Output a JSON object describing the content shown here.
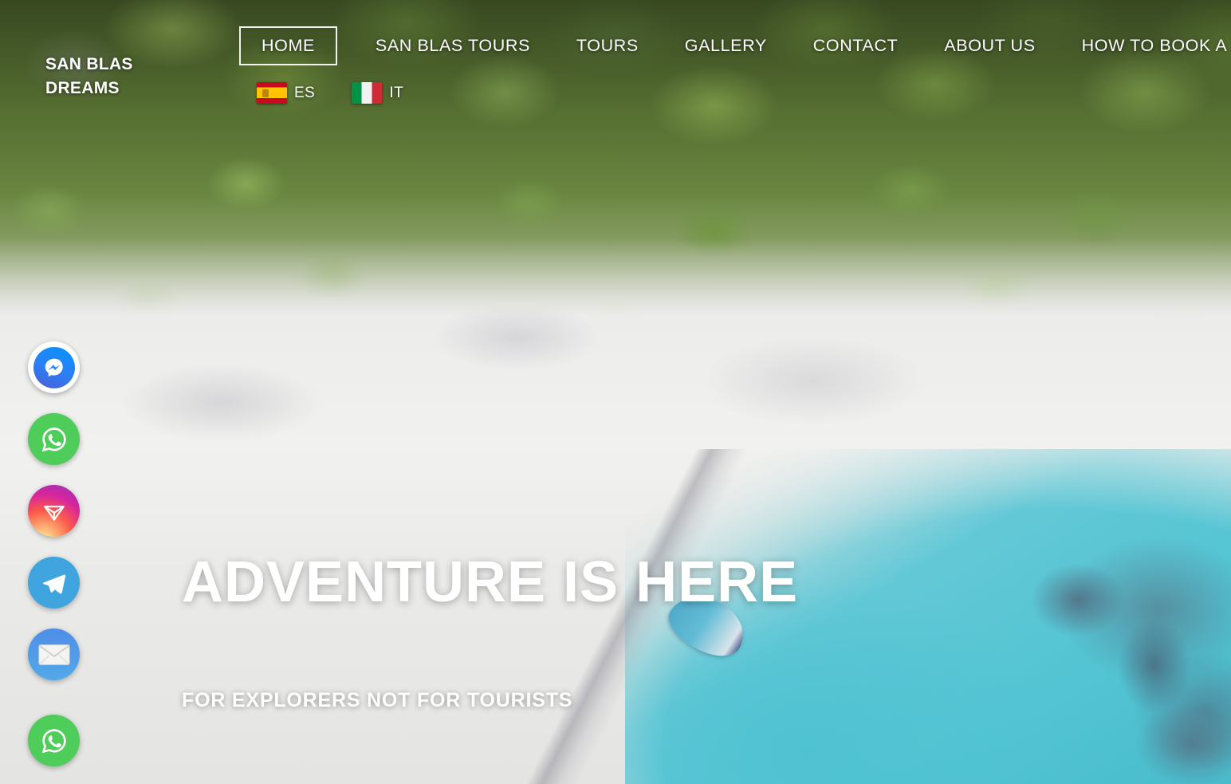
{
  "site": {
    "logo_line1": "SAN BLAS",
    "logo_line2": "DREAMS"
  },
  "nav": {
    "items": [
      {
        "label": "HOME",
        "active": true
      },
      {
        "label": "SAN BLAS TOURS",
        "active": false
      },
      {
        "label": "TOURS",
        "active": false
      },
      {
        "label": "GALLERY",
        "active": false
      },
      {
        "label": "CONTACT",
        "active": false
      },
      {
        "label": "ABOUT US",
        "active": false
      },
      {
        "label": "HOW TO BOOK A TOUR",
        "active": false
      }
    ]
  },
  "languages": [
    {
      "code": "ES",
      "flag": "spain-flag-icon"
    },
    {
      "code": "IT",
      "flag": "italy-flag-icon"
    }
  ],
  "social": [
    {
      "name": "messenger-icon",
      "color": "#0695FF"
    },
    {
      "name": "whatsapp-icon",
      "color": "#4ecd5a"
    },
    {
      "name": "instagram-direct-icon",
      "color": "#d6249f"
    },
    {
      "name": "telegram-icon",
      "color": "#40a5de"
    },
    {
      "name": "email-icon",
      "color": "#4e8ee8"
    },
    {
      "name": "whatsapp-icon",
      "color": "#4ecd5a"
    }
  ],
  "hero": {
    "title": "ADVENTURE IS HERE",
    "subtitle": "FOR EXPLORERS NOT FOR TOURISTS"
  }
}
